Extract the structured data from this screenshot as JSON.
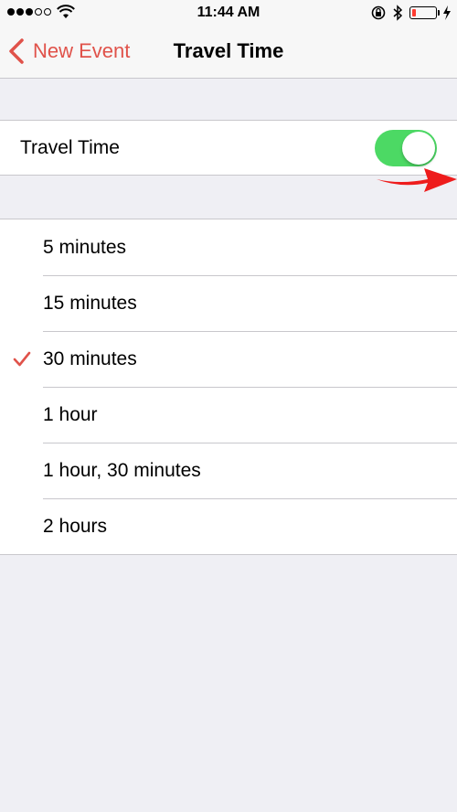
{
  "status_bar": {
    "time": "11:44 AM",
    "signal_bars_filled": 3,
    "signal_bars_total": 5,
    "battery_level": 0.15,
    "icons": [
      "signal-dots-icon",
      "wifi-icon",
      "rotation-lock-icon",
      "bluetooth-icon",
      "battery-icon",
      "charging-bolt-icon"
    ]
  },
  "nav": {
    "back_label": "New Event",
    "title": "Travel Time"
  },
  "toggle": {
    "label": "Travel Time",
    "enabled": true
  },
  "options": [
    {
      "label": "5 minutes",
      "selected": false
    },
    {
      "label": "15 minutes",
      "selected": false
    },
    {
      "label": "30 minutes",
      "selected": true
    },
    {
      "label": "1 hour",
      "selected": false
    },
    {
      "label": "1 hour, 30 minutes",
      "selected": false
    },
    {
      "label": "2 hours",
      "selected": false
    }
  ],
  "colors": {
    "accent": "#e0524a",
    "switch_on": "#4cd964",
    "background": "#efeff4",
    "annotation_arrow": "#ee1c1c"
  }
}
